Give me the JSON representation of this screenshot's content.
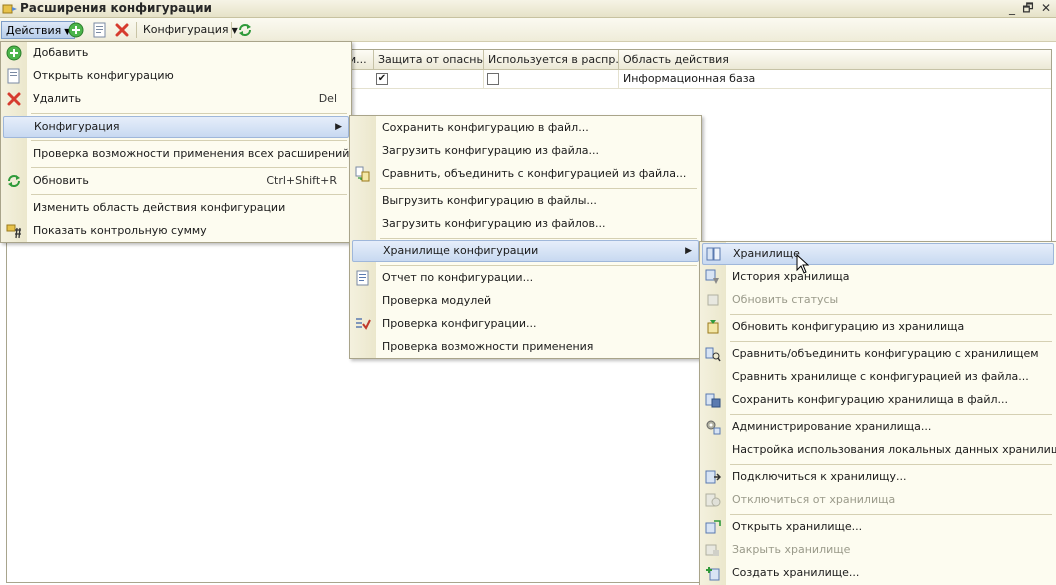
{
  "window": {
    "title": "Расширения конфигурации",
    "minimize": "_",
    "restore": "🗗",
    "close": "✕"
  },
  "toolbar": {
    "actions_label": "Действия",
    "config_label": "Конфигурация"
  },
  "table": {
    "headers": [
      "и...",
      "Защита от опасны...",
      "Используется в распр...",
      "Область действия"
    ],
    "row": {
      "protection_checked": "✔",
      "used_checked": "",
      "scope": "Информационная база"
    }
  },
  "menu_actions": {
    "items": [
      {
        "label": "Добавить",
        "shortcut": ""
      },
      {
        "label": "Открыть конфигурацию",
        "shortcut": ""
      },
      {
        "label": "Удалить",
        "shortcut": "Del"
      },
      {
        "label": "Конфигурация",
        "shortcut": ""
      },
      {
        "label": "Проверка возможности применения всех расширений",
        "shortcut": ""
      },
      {
        "label": "Обновить",
        "shortcut": "Ctrl+Shift+R"
      },
      {
        "label": "Изменить область действия конфигурации",
        "shortcut": ""
      },
      {
        "label": "Показать контрольную сумму",
        "shortcut": ""
      }
    ]
  },
  "menu_config": {
    "items": [
      {
        "label": "Сохранить конфигурацию в файл..."
      },
      {
        "label": "Загрузить конфигурацию из файла..."
      },
      {
        "label": "Сравнить, объединить с конфигурацией из файла..."
      },
      {
        "label": "Выгрузить конфигурацию в файлы..."
      },
      {
        "label": "Загрузить конфигурацию из файлов..."
      },
      {
        "label": "Хранилище конфигурации"
      },
      {
        "label": "Отчет по конфигурации..."
      },
      {
        "label": "Проверка модулей"
      },
      {
        "label": "Проверка конфигурации..."
      },
      {
        "label": "Проверка возможности применения"
      }
    ]
  },
  "menu_storage": {
    "items": [
      {
        "label": "Хранилище"
      },
      {
        "label": "История хранилища"
      },
      {
        "label": "Обновить статусы"
      },
      {
        "label": "Обновить конфигурацию из хранилища"
      },
      {
        "label": "Сравнить/объединить конфигурацию с хранилищем"
      },
      {
        "label": "Сравнить хранилище с конфигурацией из файла..."
      },
      {
        "label": "Сохранить конфигурацию хранилища в файл..."
      },
      {
        "label": "Администрирование хранилища..."
      },
      {
        "label": "Настройка использования локальных данных хранилища..."
      },
      {
        "label": "Подключиться к хранилищу..."
      },
      {
        "label": "Отключиться от хранилища"
      },
      {
        "label": "Открыть хранилище..."
      },
      {
        "label": "Закрыть хранилище"
      },
      {
        "label": "Создать хранилище..."
      }
    ]
  },
  "colors": {
    "menu_bg": "#fdfcf0",
    "highlight": "#c8d9f1",
    "disabled_text": "#9a9a8a",
    "add_green": "#3aa83a",
    "delete_red": "#d63b2f"
  }
}
